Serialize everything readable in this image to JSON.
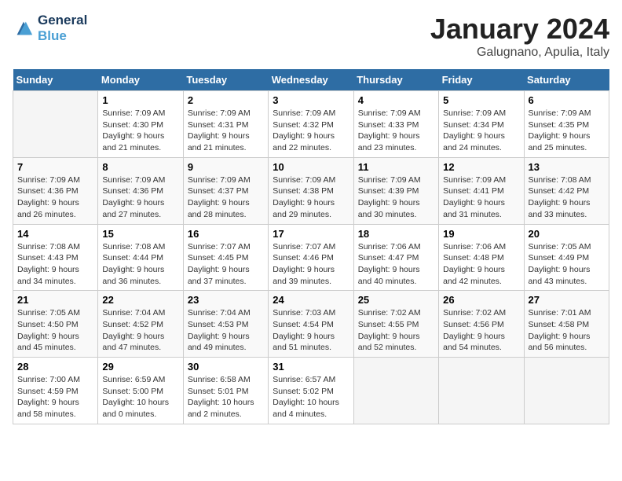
{
  "logo": {
    "line1": "General",
    "line2": "Blue"
  },
  "title": "January 2024",
  "subtitle": "Galugnano, Apulia, Italy",
  "days_header": [
    "Sunday",
    "Monday",
    "Tuesday",
    "Wednesday",
    "Thursday",
    "Friday",
    "Saturday"
  ],
  "weeks": [
    [
      {
        "day": "",
        "sunrise": "",
        "sunset": "",
        "daylight": ""
      },
      {
        "day": "1",
        "sunrise": "Sunrise: 7:09 AM",
        "sunset": "Sunset: 4:30 PM",
        "daylight": "Daylight: 9 hours and 21 minutes."
      },
      {
        "day": "2",
        "sunrise": "Sunrise: 7:09 AM",
        "sunset": "Sunset: 4:31 PM",
        "daylight": "Daylight: 9 hours and 21 minutes."
      },
      {
        "day": "3",
        "sunrise": "Sunrise: 7:09 AM",
        "sunset": "Sunset: 4:32 PM",
        "daylight": "Daylight: 9 hours and 22 minutes."
      },
      {
        "day": "4",
        "sunrise": "Sunrise: 7:09 AM",
        "sunset": "Sunset: 4:33 PM",
        "daylight": "Daylight: 9 hours and 23 minutes."
      },
      {
        "day": "5",
        "sunrise": "Sunrise: 7:09 AM",
        "sunset": "Sunset: 4:34 PM",
        "daylight": "Daylight: 9 hours and 24 minutes."
      },
      {
        "day": "6",
        "sunrise": "Sunrise: 7:09 AM",
        "sunset": "Sunset: 4:35 PM",
        "daylight": "Daylight: 9 hours and 25 minutes."
      }
    ],
    [
      {
        "day": "7",
        "sunrise": "Sunrise: 7:09 AM",
        "sunset": "Sunset: 4:36 PM",
        "daylight": "Daylight: 9 hours and 26 minutes."
      },
      {
        "day": "8",
        "sunrise": "Sunrise: 7:09 AM",
        "sunset": "Sunset: 4:36 PM",
        "daylight": "Daylight: 9 hours and 27 minutes."
      },
      {
        "day": "9",
        "sunrise": "Sunrise: 7:09 AM",
        "sunset": "Sunset: 4:37 PM",
        "daylight": "Daylight: 9 hours and 28 minutes."
      },
      {
        "day": "10",
        "sunrise": "Sunrise: 7:09 AM",
        "sunset": "Sunset: 4:38 PM",
        "daylight": "Daylight: 9 hours and 29 minutes."
      },
      {
        "day": "11",
        "sunrise": "Sunrise: 7:09 AM",
        "sunset": "Sunset: 4:39 PM",
        "daylight": "Daylight: 9 hours and 30 minutes."
      },
      {
        "day": "12",
        "sunrise": "Sunrise: 7:09 AM",
        "sunset": "Sunset: 4:41 PM",
        "daylight": "Daylight: 9 hours and 31 minutes."
      },
      {
        "day": "13",
        "sunrise": "Sunrise: 7:08 AM",
        "sunset": "Sunset: 4:42 PM",
        "daylight": "Daylight: 9 hours and 33 minutes."
      }
    ],
    [
      {
        "day": "14",
        "sunrise": "Sunrise: 7:08 AM",
        "sunset": "Sunset: 4:43 PM",
        "daylight": "Daylight: 9 hours and 34 minutes."
      },
      {
        "day": "15",
        "sunrise": "Sunrise: 7:08 AM",
        "sunset": "Sunset: 4:44 PM",
        "daylight": "Daylight: 9 hours and 36 minutes."
      },
      {
        "day": "16",
        "sunrise": "Sunrise: 7:07 AM",
        "sunset": "Sunset: 4:45 PM",
        "daylight": "Daylight: 9 hours and 37 minutes."
      },
      {
        "day": "17",
        "sunrise": "Sunrise: 7:07 AM",
        "sunset": "Sunset: 4:46 PM",
        "daylight": "Daylight: 9 hours and 39 minutes."
      },
      {
        "day": "18",
        "sunrise": "Sunrise: 7:06 AM",
        "sunset": "Sunset: 4:47 PM",
        "daylight": "Daylight: 9 hours and 40 minutes."
      },
      {
        "day": "19",
        "sunrise": "Sunrise: 7:06 AM",
        "sunset": "Sunset: 4:48 PM",
        "daylight": "Daylight: 9 hours and 42 minutes."
      },
      {
        "day": "20",
        "sunrise": "Sunrise: 7:05 AM",
        "sunset": "Sunset: 4:49 PM",
        "daylight": "Daylight: 9 hours and 43 minutes."
      }
    ],
    [
      {
        "day": "21",
        "sunrise": "Sunrise: 7:05 AM",
        "sunset": "Sunset: 4:50 PM",
        "daylight": "Daylight: 9 hours and 45 minutes."
      },
      {
        "day": "22",
        "sunrise": "Sunrise: 7:04 AM",
        "sunset": "Sunset: 4:52 PM",
        "daylight": "Daylight: 9 hours and 47 minutes."
      },
      {
        "day": "23",
        "sunrise": "Sunrise: 7:04 AM",
        "sunset": "Sunset: 4:53 PM",
        "daylight": "Daylight: 9 hours and 49 minutes."
      },
      {
        "day": "24",
        "sunrise": "Sunrise: 7:03 AM",
        "sunset": "Sunset: 4:54 PM",
        "daylight": "Daylight: 9 hours and 51 minutes."
      },
      {
        "day": "25",
        "sunrise": "Sunrise: 7:02 AM",
        "sunset": "Sunset: 4:55 PM",
        "daylight": "Daylight: 9 hours and 52 minutes."
      },
      {
        "day": "26",
        "sunrise": "Sunrise: 7:02 AM",
        "sunset": "Sunset: 4:56 PM",
        "daylight": "Daylight: 9 hours and 54 minutes."
      },
      {
        "day": "27",
        "sunrise": "Sunrise: 7:01 AM",
        "sunset": "Sunset: 4:58 PM",
        "daylight": "Daylight: 9 hours and 56 minutes."
      }
    ],
    [
      {
        "day": "28",
        "sunrise": "Sunrise: 7:00 AM",
        "sunset": "Sunset: 4:59 PM",
        "daylight": "Daylight: 9 hours and 58 minutes."
      },
      {
        "day": "29",
        "sunrise": "Sunrise: 6:59 AM",
        "sunset": "Sunset: 5:00 PM",
        "daylight": "Daylight: 10 hours and 0 minutes."
      },
      {
        "day": "30",
        "sunrise": "Sunrise: 6:58 AM",
        "sunset": "Sunset: 5:01 PM",
        "daylight": "Daylight: 10 hours and 2 minutes."
      },
      {
        "day": "31",
        "sunrise": "Sunrise: 6:57 AM",
        "sunset": "Sunset: 5:02 PM",
        "daylight": "Daylight: 10 hours and 4 minutes."
      },
      {
        "day": "",
        "sunrise": "",
        "sunset": "",
        "daylight": ""
      },
      {
        "day": "",
        "sunrise": "",
        "sunset": "",
        "daylight": ""
      },
      {
        "day": "",
        "sunrise": "",
        "sunset": "",
        "daylight": ""
      }
    ]
  ]
}
